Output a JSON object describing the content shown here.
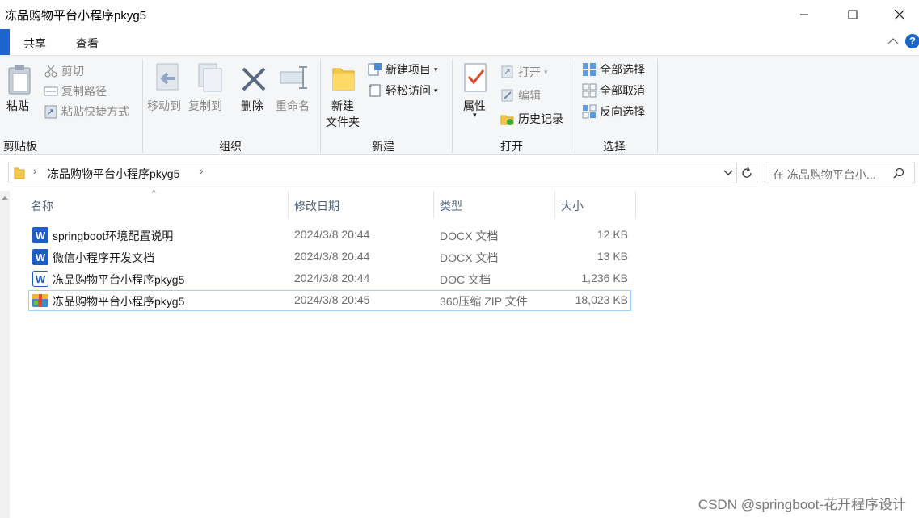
{
  "window": {
    "title": "冻品购物平台小程序pkyg5",
    "minimize": "—",
    "maximize": "☐",
    "close": "✕"
  },
  "ribbon_tabs": [
    "共享",
    "查看"
  ],
  "ribbon": {
    "clipboard": {
      "label": "剪贴板",
      "paste": "粘贴",
      "cut": "剪切",
      "copy_path": "复制路径",
      "paste_shortcut": "粘贴快捷方式"
    },
    "organize": {
      "label": "组织",
      "move_to": "移动到",
      "copy_to": "复制到",
      "delete": "删除",
      "rename": "重命名"
    },
    "new": {
      "label": "新建",
      "new_folder_line1": "新建",
      "new_folder_line2": "文件夹",
      "new_item": "新建项目",
      "easy_access": "轻松访问"
    },
    "open": {
      "label": "打开",
      "properties": "属性",
      "open": "打开",
      "edit": "编辑",
      "history": "历史记录"
    },
    "select": {
      "label": "选择",
      "select_all": "全部选择",
      "select_none": "全部取消",
      "invert": "反向选择"
    }
  },
  "address": {
    "path": "冻品购物平台小程序pkyg5",
    "search_placeholder": "在 冻品购物平台小..."
  },
  "columns": {
    "name": "名称",
    "date": "修改日期",
    "type": "类型",
    "size": "大小"
  },
  "files": [
    {
      "name": "springboot环境配置说明",
      "date": "2024/3/8 20:44",
      "type": "DOCX 文档",
      "size": "12 KB",
      "icon": "word-docx-icon"
    },
    {
      "name": "微信小程序开发文档",
      "date": "2024/3/8 20:44",
      "type": "DOCX 文档",
      "size": "13 KB",
      "icon": "word-docx-icon"
    },
    {
      "name": "冻品购物平台小程序pkyg5",
      "date": "2024/3/8 20:44",
      "type": "DOC 文档",
      "size": "1,236 KB",
      "icon": "word-doc-icon"
    },
    {
      "name": "冻品购物平台小程序pkyg5",
      "date": "2024/3/8 20:45",
      "type": "360压缩 ZIP 文件",
      "size": "18,023 KB",
      "icon": "zip-archive-icon",
      "selected": true
    }
  ],
  "watermark": "CSDN @springboot-花开程序设计",
  "colors": {
    "accent": "#0a64c9",
    "selection_border": "#99d1ff",
    "header_text": "#4c607a"
  }
}
